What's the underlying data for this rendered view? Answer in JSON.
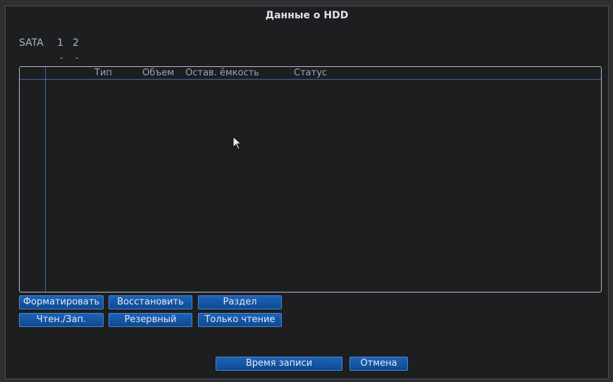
{
  "title": "Данные о HDD",
  "sata": {
    "label": "SATA",
    "disks": [
      "1",
      "2"
    ],
    "disk_status": [
      "-",
      "-"
    ]
  },
  "table": {
    "columns": [
      "Тип",
      "Объем",
      "Остав. ёмкость",
      "Статус"
    ],
    "rows": []
  },
  "buttons": {
    "format": "Форматировать",
    "restore": "Восстановить",
    "partition": "Раздел",
    "read_write": "Чтен./Зап.",
    "backup": "Резервный",
    "read_only": "Только чтение",
    "record_time": "Время записи",
    "cancel": "Отмена"
  },
  "icons": {
    "cursor": "mouse-pointer-icon"
  }
}
